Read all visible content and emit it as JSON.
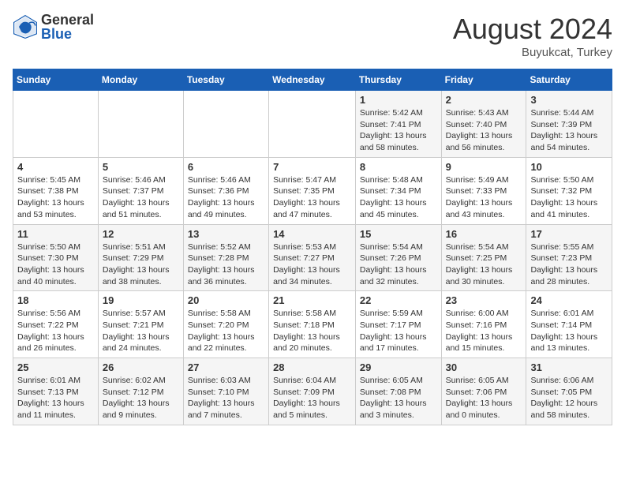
{
  "header": {
    "logo": {
      "general": "General",
      "blue": "Blue"
    },
    "month_year": "August 2024",
    "location": "Buyukcat, Turkey"
  },
  "weekdays": [
    "Sunday",
    "Monday",
    "Tuesday",
    "Wednesday",
    "Thursday",
    "Friday",
    "Saturday"
  ],
  "weeks": [
    [
      {
        "day": "",
        "info": ""
      },
      {
        "day": "",
        "info": ""
      },
      {
        "day": "",
        "info": ""
      },
      {
        "day": "",
        "info": ""
      },
      {
        "day": "1",
        "info": "Sunrise: 5:42 AM\nSunset: 7:41 PM\nDaylight: 13 hours\nand 58 minutes."
      },
      {
        "day": "2",
        "info": "Sunrise: 5:43 AM\nSunset: 7:40 PM\nDaylight: 13 hours\nand 56 minutes."
      },
      {
        "day": "3",
        "info": "Sunrise: 5:44 AM\nSunset: 7:39 PM\nDaylight: 13 hours\nand 54 minutes."
      }
    ],
    [
      {
        "day": "4",
        "info": "Sunrise: 5:45 AM\nSunset: 7:38 PM\nDaylight: 13 hours\nand 53 minutes."
      },
      {
        "day": "5",
        "info": "Sunrise: 5:46 AM\nSunset: 7:37 PM\nDaylight: 13 hours\nand 51 minutes."
      },
      {
        "day": "6",
        "info": "Sunrise: 5:46 AM\nSunset: 7:36 PM\nDaylight: 13 hours\nand 49 minutes."
      },
      {
        "day": "7",
        "info": "Sunrise: 5:47 AM\nSunset: 7:35 PM\nDaylight: 13 hours\nand 47 minutes."
      },
      {
        "day": "8",
        "info": "Sunrise: 5:48 AM\nSunset: 7:34 PM\nDaylight: 13 hours\nand 45 minutes."
      },
      {
        "day": "9",
        "info": "Sunrise: 5:49 AM\nSunset: 7:33 PM\nDaylight: 13 hours\nand 43 minutes."
      },
      {
        "day": "10",
        "info": "Sunrise: 5:50 AM\nSunset: 7:32 PM\nDaylight: 13 hours\nand 41 minutes."
      }
    ],
    [
      {
        "day": "11",
        "info": "Sunrise: 5:50 AM\nSunset: 7:30 PM\nDaylight: 13 hours\nand 40 minutes."
      },
      {
        "day": "12",
        "info": "Sunrise: 5:51 AM\nSunset: 7:29 PM\nDaylight: 13 hours\nand 38 minutes."
      },
      {
        "day": "13",
        "info": "Sunrise: 5:52 AM\nSunset: 7:28 PM\nDaylight: 13 hours\nand 36 minutes."
      },
      {
        "day": "14",
        "info": "Sunrise: 5:53 AM\nSunset: 7:27 PM\nDaylight: 13 hours\nand 34 minutes."
      },
      {
        "day": "15",
        "info": "Sunrise: 5:54 AM\nSunset: 7:26 PM\nDaylight: 13 hours\nand 32 minutes."
      },
      {
        "day": "16",
        "info": "Sunrise: 5:54 AM\nSunset: 7:25 PM\nDaylight: 13 hours\nand 30 minutes."
      },
      {
        "day": "17",
        "info": "Sunrise: 5:55 AM\nSunset: 7:23 PM\nDaylight: 13 hours\nand 28 minutes."
      }
    ],
    [
      {
        "day": "18",
        "info": "Sunrise: 5:56 AM\nSunset: 7:22 PM\nDaylight: 13 hours\nand 26 minutes."
      },
      {
        "day": "19",
        "info": "Sunrise: 5:57 AM\nSunset: 7:21 PM\nDaylight: 13 hours\nand 24 minutes."
      },
      {
        "day": "20",
        "info": "Sunrise: 5:58 AM\nSunset: 7:20 PM\nDaylight: 13 hours\nand 22 minutes."
      },
      {
        "day": "21",
        "info": "Sunrise: 5:58 AM\nSunset: 7:18 PM\nDaylight: 13 hours\nand 20 minutes."
      },
      {
        "day": "22",
        "info": "Sunrise: 5:59 AM\nSunset: 7:17 PM\nDaylight: 13 hours\nand 17 minutes."
      },
      {
        "day": "23",
        "info": "Sunrise: 6:00 AM\nSunset: 7:16 PM\nDaylight: 13 hours\nand 15 minutes."
      },
      {
        "day": "24",
        "info": "Sunrise: 6:01 AM\nSunset: 7:14 PM\nDaylight: 13 hours\nand 13 minutes."
      }
    ],
    [
      {
        "day": "25",
        "info": "Sunrise: 6:01 AM\nSunset: 7:13 PM\nDaylight: 13 hours\nand 11 minutes."
      },
      {
        "day": "26",
        "info": "Sunrise: 6:02 AM\nSunset: 7:12 PM\nDaylight: 13 hours\nand 9 minutes."
      },
      {
        "day": "27",
        "info": "Sunrise: 6:03 AM\nSunset: 7:10 PM\nDaylight: 13 hours\nand 7 minutes."
      },
      {
        "day": "28",
        "info": "Sunrise: 6:04 AM\nSunset: 7:09 PM\nDaylight: 13 hours\nand 5 minutes."
      },
      {
        "day": "29",
        "info": "Sunrise: 6:05 AM\nSunset: 7:08 PM\nDaylight: 13 hours\nand 3 minutes."
      },
      {
        "day": "30",
        "info": "Sunrise: 6:05 AM\nSunset: 7:06 PM\nDaylight: 13 hours\nand 0 minutes."
      },
      {
        "day": "31",
        "info": "Sunrise: 6:06 AM\nSunset: 7:05 PM\nDaylight: 12 hours\nand 58 minutes."
      }
    ]
  ]
}
